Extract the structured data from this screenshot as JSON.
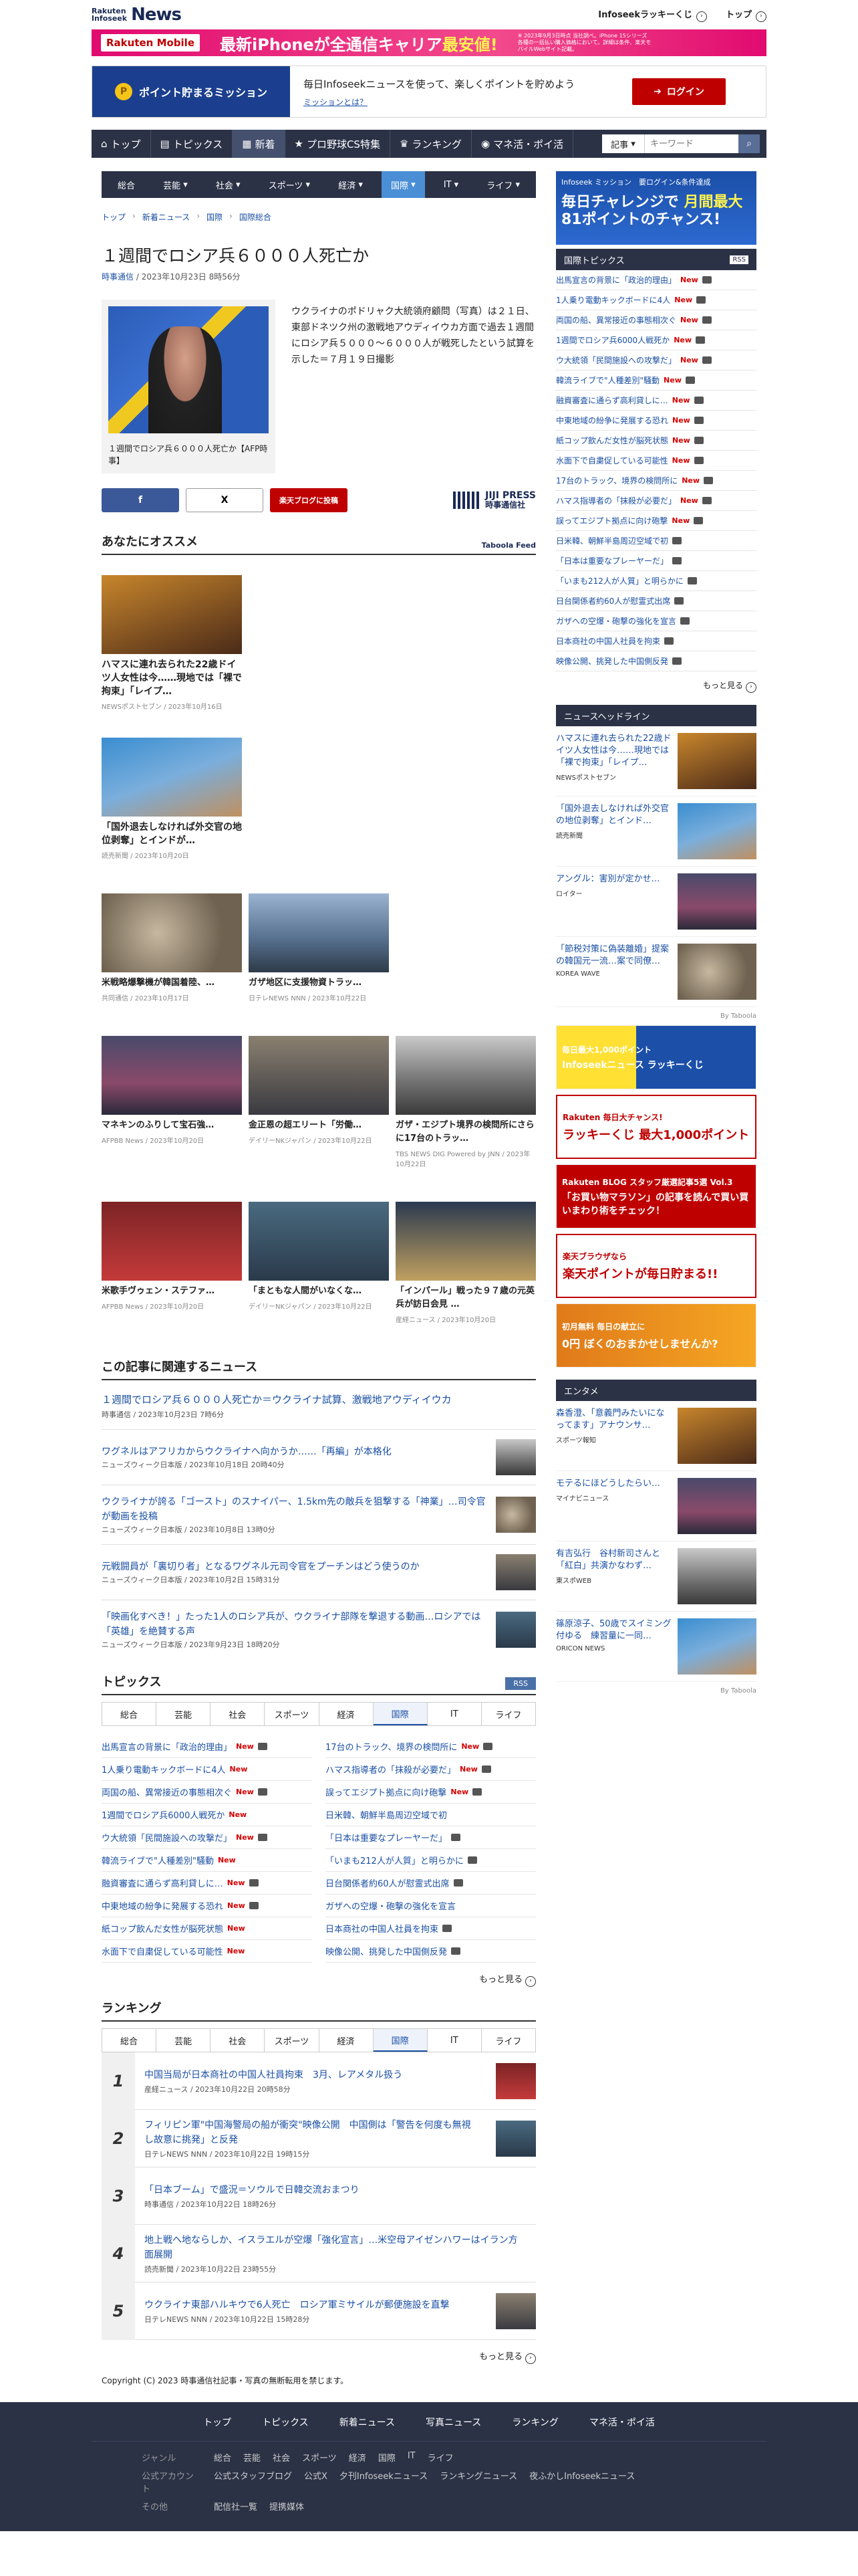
{
  "header": {
    "logo_small": "Rakuten\nInfoseek",
    "logo_big": "News",
    "lottery": "Infoseekラッキーくじ",
    "top": "トップ"
  },
  "ad_banner": {
    "brand": "Rakuten Mobile",
    "text_a": "最新",
    "text_b": "iPhone",
    "text_c": "が全通信キャリア",
    "text_d": "最安値!",
    "note": "※ 2023年9月3日時点 当社調べ。iPhone 15シリーズ各種の一括払い購入価格において。詳細は条件、楽天モバイルWebサイト記載。"
  },
  "mission": {
    "label": "ポイント貯まるミッション",
    "desc": "毎日Infoseekニュースを使って、楽しくポイントを貯めよう",
    "link": "ミッションとは？",
    "login": "ログイン"
  },
  "global_nav": {
    "items": [
      "トップ",
      "トピックス",
      "新着",
      "プロ野球CS特集",
      "ランキング",
      "マネ活・ポイ活"
    ],
    "search_select": "記事",
    "search_placeholder": "キーワード"
  },
  "category_nav": [
    "総合",
    "芸能",
    "社会",
    "スポーツ",
    "経済",
    "国際",
    "IT",
    "ライフ"
  ],
  "breadcrumb": [
    "トップ",
    "新着ニュース",
    "国際",
    "国際総合"
  ],
  "article": {
    "title": "１週間でロシア兵６０００人死亡か",
    "source": "時事通信",
    "date": "/ 2023年10月23日 8時56分",
    "lead": "ウクライナのポドリャク大統領府顧問（写真）は２１日、東部ドネツク州の激戦地アウディイウカ方面で過去１週間にロシア兵５０００～６０００人が戦死したという試算を示した＝７月１９日撮影",
    "caption": "１週間でロシア兵６０００人死亡か【AFP時事】",
    "share_fb": "f",
    "share_x": "X",
    "share_rk": "楽天ブログに投稿",
    "publisher": "JIJI PRESS",
    "publisher_jp": "時事通信社"
  },
  "recommend": {
    "title": "あなたにオススメ",
    "taboola": "Taboola Feed",
    "cards_single": [
      {
        "title": "ハマスに連れ去られた22歳ドイツ人女性は今……現地では「裸で拘束」「レイプ…",
        "src": "NEWSポストセブン / 2023年10月16日"
      },
      {
        "title": "「国外退去しなければ外交官の地位剥奪」とインドが…",
        "src": "読売新聞 / 2023年10月20日"
      }
    ],
    "cards_grid": [
      {
        "title": "米戦略爆撃機が韓国着陸、…",
        "src": "共同通信 / 2023年10月17日"
      },
      {
        "title": "ガザ地区に支援物資トラッ…",
        "src": "日テレNEWS NNN / 2023年10月22日"
      },
      {
        "title": "マネキンのふりして宝石強…",
        "src": "AFPBB News / 2023年10月20日"
      },
      {
        "title": "金正恩の超エリート「労働…",
        "src": "デイリーNKジャパン / 2023年10月22日"
      },
      {
        "title": "ガザ・エジプト境界の検問所にさらに17台のトラッ…",
        "src": "TBS NEWS DIG Powered by JNN / 2023年10月22日"
      },
      {
        "title": "米歌手ヴゥェン・ステファ…",
        "src": "AFPBB News / 2023年10月20日"
      },
      {
        "title": "「まともな人間がいなくな…",
        "src": "デイリーNKジャパン / 2023年10月22日"
      },
      {
        "title": "「インパール」戦った９７歳の元英兵が訪日会見 …",
        "src": "産経ニュース / 2023年10月20日"
      }
    ]
  },
  "related": {
    "title": "この記事に関連するニュース",
    "main": {
      "title": "１週間でロシア兵６０００人死亡か＝ウクライナ試算、激戦地アウディイウカ",
      "src": "時事通信 / 2023年10月23日 7時6分"
    },
    "items": [
      {
        "title": "ワグネルはアフリカからウクライナへ向かうか……「再編」が本格化",
        "src": "ニューズウィーク日本版 / 2023年10月18日 20時40分"
      },
      {
        "title": "ウクライナが誇る「ゴースト」のスナイパー、1.5km先の敵兵を狙撃する「神業」…司令官が動画を投稿",
        "src": "ニューズウィーク日本版 / 2023年10月8日 13時0分"
      },
      {
        "title": "元戦闘員が「裏切り者」となるワグネル元司令官をプーチンはどう使うのか",
        "src": "ニューズウィーク日本版 / 2023年10月2日 15時31分"
      },
      {
        "title": "「映画化すべき！」たった1人のロシア兵が、ウクライナ部隊を撃退する動画…ロシアでは「英雄」を絶賛する声",
        "src": "ニューズウィーク日本版 / 2023年9月23日 18時20分"
      }
    ]
  },
  "topics": {
    "title": "トピックス",
    "rss": "RSS",
    "left": [
      {
        "t": "出馬宣言の背景に「政治的理由」",
        "n": "New",
        "c": true
      },
      {
        "t": "1人乗り電動キックボードに4人",
        "n": "New",
        "c": false
      },
      {
        "t": "両国の船、異常接近の事態相次ぐ",
        "n": "New",
        "c": true
      },
      {
        "t": "1週間でロシア兵6000人戦死か",
        "n": "New",
        "c": false
      },
      {
        "t": "ウ大統領「民間施設への攻撃だ」",
        "n": "New",
        "c": true
      },
      {
        "t": "韓流ライブで\"人種差別\"騒動",
        "n": "New",
        "c": false
      },
      {
        "t": "融資審査に通らず高利貸しに…",
        "n": "New",
        "c": true
      },
      {
        "t": "中東地域の紛争に発展する恐れ",
        "n": "New",
        "c": true
      },
      {
        "t": "紙コップ飲んだ女性が脳死状態",
        "n": "New",
        "c": false
      },
      {
        "t": "水面下で自粛促している可能性",
        "n": "New",
        "c": false
      }
    ],
    "right": [
      {
        "t": "17台のトラック、境界の検問所に",
        "n": "New",
        "c": true
      },
      {
        "t": "ハマス指導者の「抹殺が必要だ」",
        "n": "New",
        "c": true
      },
      {
        "t": "誤ってエジプト拠点に向け砲撃",
        "n": "New",
        "c": true
      },
      {
        "t": "日米韓、朝鮮半島周辺空域で初",
        "n": "",
        "c": false
      },
      {
        "t": "「日本は重要なプレーヤーだ」",
        "n": "",
        "c": true
      },
      {
        "t": "「いまも212人が人質」と明らかに",
        "n": "",
        "c": true
      },
      {
        "t": "日台関係者約60人が慰霊式出席",
        "n": "",
        "c": true
      },
      {
        "t": "ガザへの空爆・砲撃の強化を宣言",
        "n": "",
        "c": false
      },
      {
        "t": "日本商社の中国人社員を拘束",
        "n": "",
        "c": true
      },
      {
        "t": "映像公開、挑発した中国側反発",
        "n": "",
        "c": true
      }
    ],
    "more": "もっと見る"
  },
  "ranking": {
    "title": "ランキング",
    "items": [
      {
        "no": "1",
        "t": "中国当局が日本商社の中国人社員拘束　3月、レアメタル扱う",
        "s": "産経ニュース / 2023年10月22日 20時58分"
      },
      {
        "no": "2",
        "t": "フィリピン軍\"中国海警局の船が衝突\"映像公開　中国側は「警告を何度も無視し故意に挑発」と反発",
        "s": "日テレNEWS NNN / 2023年10月22日 19時15分"
      },
      {
        "no": "3",
        "t": "「日本ブーム」で盛況＝ソウルで日韓交流おまつり",
        "s": "時事通信 / 2023年10月22日 18時26分"
      },
      {
        "no": "4",
        "t": "地上戦へ地ならしか、イスラエルが空爆「強化宣言」…米空母アイゼンハワーはイラン方面展開",
        "s": "読売新聞 / 2023年10月22日 23時55分"
      },
      {
        "no": "5",
        "t": "ウクライナ東部ハルキウで6人死亡　ロシア軍ミサイルが郵便施設を直撃",
        "s": "日テレNEWS NNN / 2023年10月22日 15時28分"
      }
    ],
    "more": "もっと見る"
  },
  "copyright": "Copyright (C) 2023 時事通信社記事・写真の無断転用を禁じます。",
  "sidebar": {
    "ad_top": "Infoseek ミッション",
    "ad_note": "要ログイン&条件達成",
    "ad_big": "毎日チャレンジで",
    "ad_big2": "月間最大",
    "ad_big3": "81ポイントのチャンス!",
    "topics_head": "国際トピックス",
    "topics": [
      {
        "t": "出馬宣言の背景に「政治的理由」",
        "n": "New"
      },
      {
        "t": "1人乗り電動キックボードに4人",
        "n": "New"
      },
      {
        "t": "両国の船、異常接近の事態相次ぐ",
        "n": "New"
      },
      {
        "t": "1週間でロシア兵6000人戦死か",
        "n": "New"
      },
      {
        "t": "ウ大統領「民間施設への攻撃だ」",
        "n": "New"
      },
      {
        "t": "韓流ライブで\"人種差別\"騒動",
        "n": "New"
      },
      {
        "t": "融資審査に通らず高利貸しに…",
        "n": "New"
      },
      {
        "t": "中東地域の紛争に発展する恐れ",
        "n": "New"
      },
      {
        "t": "紙コップ飲んだ女性が脳死状態",
        "n": "New"
      },
      {
        "t": "水面下で自粛促している可能性",
        "n": "New"
      },
      {
        "t": "17台のトラック、境界の検問所に",
        "n": "New"
      },
      {
        "t": "ハマス指導者の「抹殺が必要だ」",
        "n": "New"
      },
      {
        "t": "誤ってエジプト拠点に向け砲撃",
        "n": "New"
      },
      {
        "t": "日米韓、朝鮮半島周辺空域で初",
        "n": ""
      },
      {
        "t": "「日本は重要なプレーヤーだ」",
        "n": ""
      },
      {
        "t": "「いまも212人が人質」と明らかに",
        "n": ""
      },
      {
        "t": "日台関係者約60人が慰霊式出席",
        "n": ""
      },
      {
        "t": "ガザへの空爆・砲撃の強化を宣言",
        "n": ""
      },
      {
        "t": "日本商社の中国人社員を拘束",
        "n": ""
      },
      {
        "t": "映像公開、挑発した中国側反発",
        "n": ""
      }
    ],
    "more": "もっと見る",
    "headline_head": "ニュースヘッドライン",
    "headlines": [
      {
        "t": "ハマスに連れ去られた22歳ドイツ人女性は今……現地では「裸で拘束」「レイプ…",
        "s": "NEWSポストセブン"
      },
      {
        "t": "「国外退去しなければ外交官の地位剥奪」とインド…",
        "s": "読売新聞"
      },
      {
        "t": "アングル：害別が定かせ…",
        "s": "ロイター"
      },
      {
        "t": "「節税対策に偽装離婚」提案の韓国元一流…案で同僚…",
        "s": "KOREA WAVE"
      }
    ],
    "by_taboola": "By Taboola",
    "promos": [
      {
        "a": "毎日最大1,000ポイント",
        "b": "Infoseekニュース ラッキーくじ"
      },
      {
        "a": "Rakuten 毎日大チャンス!",
        "b": "ラッキーくじ 最大1,000ポイント"
      },
      {
        "a": "Rakuten BLOG スタッフ厳選記事5選 Vol.3",
        "b": "「お買い物マラソン」の記事を読んで買い買いまわり術をチェック！"
      },
      {
        "a": "楽天ブラウザなら",
        "b": "楽天ポイントが毎日貯まる!!"
      },
      {
        "a": "初月無料 毎日の献立に",
        "b": "0円 ぼくのおまかせしませんか?"
      }
    ],
    "ent_head": "エンタメ",
    "ent": [
      {
        "t": "森香澄、「意義門みたいになってます」アナウンサ…",
        "s": "スポーツ報知"
      },
      {
        "t": "モテるにほどうしたらい…",
        "s": "マイナビニュース"
      },
      {
        "t": "有吉弘行　谷村新司さんと「紅白」共演かなわず…",
        "s": "東スポWEB"
      },
      {
        "t": "篠原涼子、50歳でスイミング付ゆる　練習量に一同…",
        "s": "ORICON NEWS"
      }
    ]
  },
  "footer": {
    "nav": [
      "トップ",
      "トピックス",
      "新着ニュース",
      "写真ニュース",
      "ランキング",
      "マネ活・ポイ活"
    ],
    "rows": [
      {
        "lab": "ジャンル",
        "items": [
          "総合",
          "芸能",
          "社会",
          "スポーツ",
          "経済",
          "国際",
          "IT",
          "ライフ"
        ]
      },
      {
        "lab": "公式アカウント",
        "items": [
          "公式スタッフブログ",
          "公式X",
          "夕刊Infoseekニュース",
          "ランキングニュース",
          "夜ふかしInfoseekニュース"
        ]
      },
      {
        "lab": "その他",
        "items": [
          "配信社一覧",
          "提携媒体"
        ]
      }
    ]
  },
  "colors": {
    "nav": "#2b3246",
    "accent": "#1a4fa3",
    "rakuten_red": "#bf0000",
    "new": "#d40000"
  }
}
